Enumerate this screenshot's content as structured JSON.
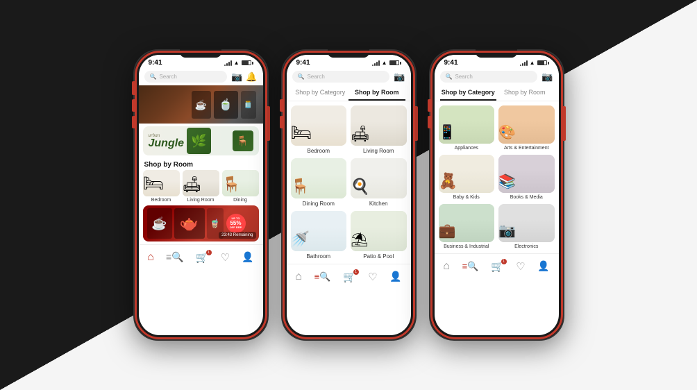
{
  "phones": [
    {
      "id": "phone1",
      "status": {
        "time": "9:41",
        "signal": "full",
        "wifi": true,
        "battery": "full"
      },
      "search": {
        "placeholder": "Search",
        "label": "Search"
      },
      "sections": [
        {
          "type": "hero",
          "label": "hero-coffee"
        },
        {
          "type": "banner",
          "brand": "urban",
          "title": "Jungle",
          "label": "jungle-banner"
        },
        {
          "type": "section",
          "title": "Shop by Room",
          "items": [
            {
              "label": "Bedroom",
              "theme": "bedroom"
            },
            {
              "label": "Living Room",
              "theme": "living"
            },
            {
              "label": "Dining",
              "theme": "dining"
            }
          ]
        },
        {
          "type": "promo",
          "badge": "UP TO\n55%\nOFF RRP",
          "timer": "23:43 Remaining",
          "label": "promo-banner"
        }
      ],
      "nav": [
        {
          "icon": "🏠",
          "label": "home",
          "active": true
        },
        {
          "icon": "≡",
          "label": "search",
          "active": false,
          "badge": null
        },
        {
          "icon": "🛒",
          "label": "cart",
          "active": false,
          "badge": "1"
        },
        {
          "icon": "♡",
          "label": "wishlist",
          "active": false
        },
        {
          "icon": "👤",
          "label": "profile",
          "active": false
        }
      ]
    },
    {
      "id": "phone2",
      "status": {
        "time": "9:41",
        "signal": "full",
        "wifi": true,
        "battery": "full"
      },
      "search": {
        "placeholder": "Search",
        "label": "Search"
      },
      "tabs": [
        {
          "label": "Shop by Category",
          "active": false
        },
        {
          "label": "Shop by Room",
          "active": true
        }
      ],
      "rooms": [
        {
          "label": "Bedroom",
          "theme": "bedroom"
        },
        {
          "label": "Living Room",
          "theme": "living"
        },
        {
          "label": "Dining Room",
          "theme": "dining"
        },
        {
          "label": "Kitchen",
          "theme": "kitchen"
        },
        {
          "label": "Bathroom",
          "theme": "bathroom"
        },
        {
          "label": "Patio & Pool",
          "theme": "patio"
        }
      ],
      "nav": [
        {
          "icon": "🏠",
          "label": "home",
          "active": false
        },
        {
          "icon": "≡",
          "label": "search",
          "active": true,
          "badge": null
        },
        {
          "icon": "🛒",
          "label": "cart",
          "active": false,
          "badge": "1"
        },
        {
          "icon": "♡",
          "label": "wishlist",
          "active": false
        },
        {
          "icon": "👤",
          "label": "profile",
          "active": false
        }
      ]
    },
    {
      "id": "phone3",
      "status": {
        "time": "9:41",
        "signal": "full",
        "wifi": true,
        "battery": "full"
      },
      "search": {
        "placeholder": "Search",
        "label": "Search"
      },
      "tabs": [
        {
          "label": "Shop by Category",
          "active": true
        },
        {
          "label": "Shop by Room",
          "active": false
        }
      ],
      "categories": [
        {
          "label": "Appliances",
          "theme": "appliance"
        },
        {
          "label": "Arts & Entertainment",
          "theme": "arts"
        },
        {
          "label": "Baby & Kids",
          "theme": "baby"
        },
        {
          "label": "Books & Media",
          "theme": "books"
        },
        {
          "label": "Business & Industrial",
          "theme": "business"
        },
        {
          "label": "Electronics",
          "theme": "electronics"
        }
      ],
      "nav": [
        {
          "icon": "🏠",
          "label": "home",
          "active": false
        },
        {
          "icon": "≡",
          "label": "search",
          "active": true,
          "badge": null
        },
        {
          "icon": "🛒",
          "label": "cart",
          "active": false,
          "badge": "1"
        },
        {
          "icon": "♡",
          "label": "wishlist",
          "active": false
        },
        {
          "icon": "👤",
          "label": "profile",
          "active": false
        }
      ]
    }
  ],
  "icons": {
    "search": "🔍",
    "camera": "📷",
    "bell": "🔔",
    "home": "⌂",
    "search_nav": "≡",
    "cart": "⊙",
    "heart": "♡",
    "user": "⊛"
  }
}
